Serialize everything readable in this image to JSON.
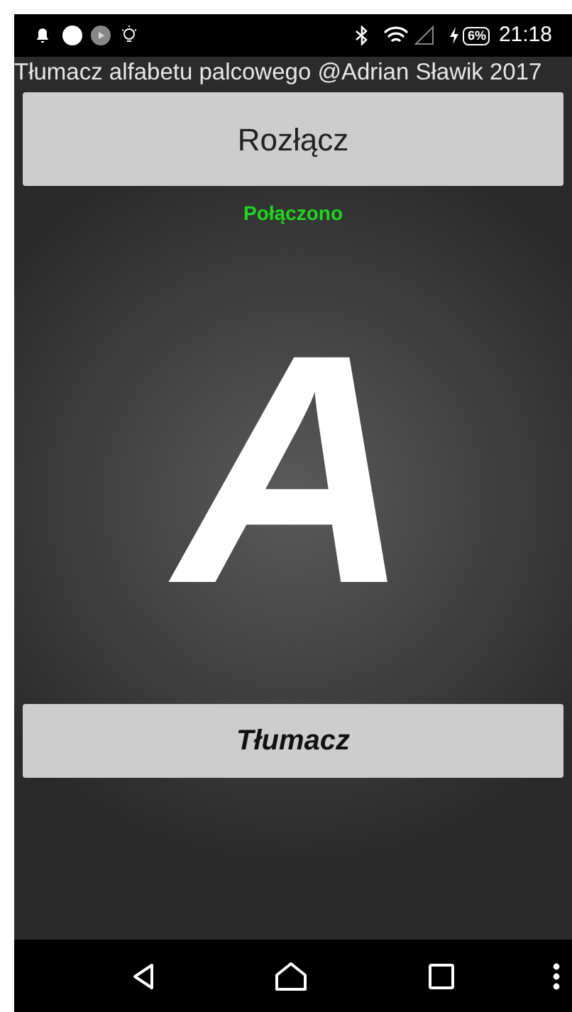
{
  "status_bar": {
    "battery": "6%",
    "time": "21:18"
  },
  "title": "Tłumacz alfabetu palcowego @Adrian Sławik 2017",
  "disconnect_button": "Rozłącz",
  "status_text": "Połączono",
  "letter": "A",
  "translate_button": "Tłumacz"
}
